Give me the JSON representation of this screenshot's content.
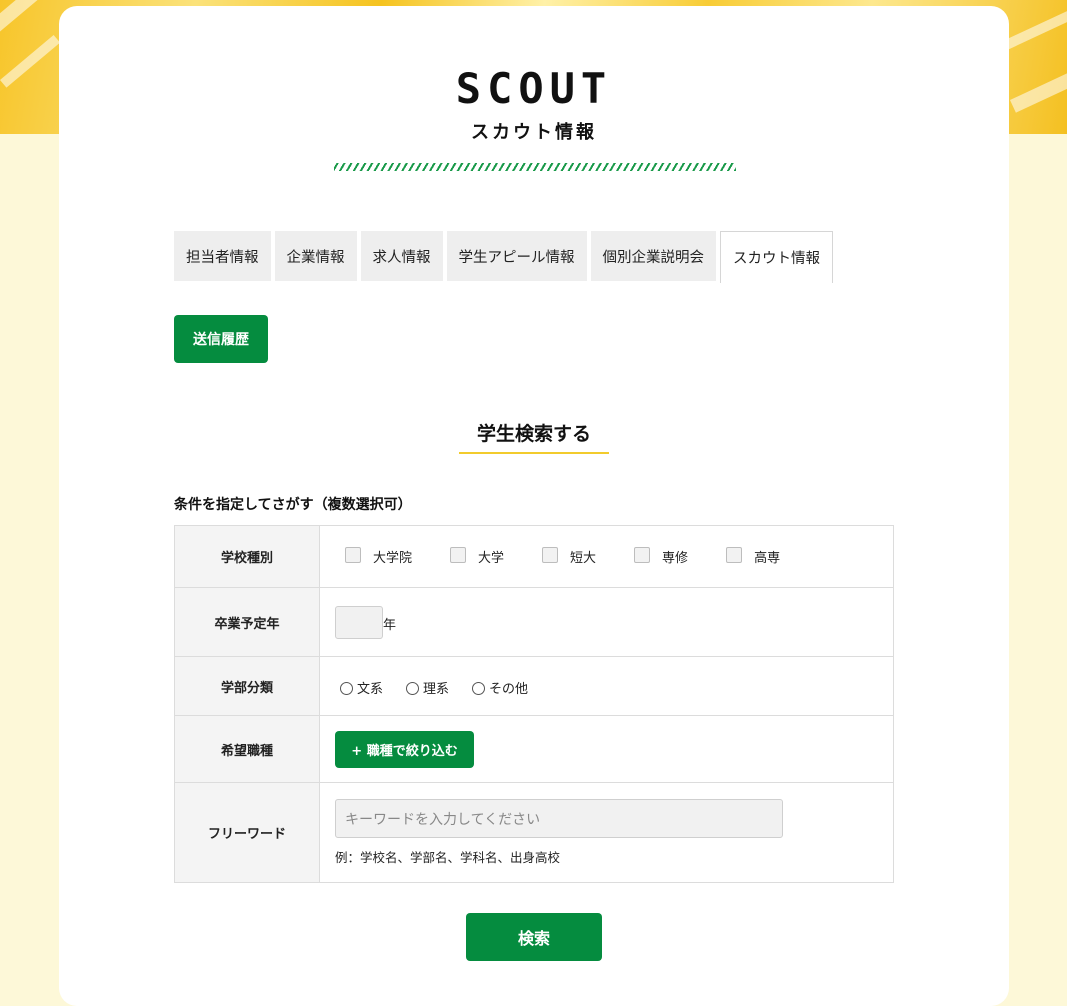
{
  "logo": {
    "title": "SCOUT",
    "subtitle": "スカウト情報"
  },
  "tabs": [
    {
      "label": "担当者情報",
      "active": false
    },
    {
      "label": "企業情報",
      "active": false
    },
    {
      "label": "求人情報",
      "active": false
    },
    {
      "label": "学生アピール情報",
      "active": false
    },
    {
      "label": "個別企業説明会",
      "active": false
    },
    {
      "label": "スカウト情報",
      "active": true
    }
  ],
  "history_button": "送信履歴",
  "section_title": "学生検索する",
  "conditions_label": "条件を指定してさがす（複数選択可）",
  "form": {
    "school_type": {
      "label": "学校種別",
      "options": [
        "大学院",
        "大学",
        "短大",
        "専修",
        "高専"
      ]
    },
    "graduation_year": {
      "label": "卒業予定年",
      "value": "",
      "unit": "年"
    },
    "faculty": {
      "label": "学部分類",
      "options": [
        "文系",
        "理系",
        "その他"
      ]
    },
    "job_type": {
      "label": "希望職種",
      "button": "+ 職種で絞り込む"
    },
    "freeword": {
      "label": "フリーワード",
      "placeholder": "キーワードを入力してください",
      "hint": "例：学校名、学部名、学科名、出身高校"
    }
  },
  "search_button": "検索",
  "colors": {
    "accent_green": "#058c3f",
    "accent_yellow": "#f2cb2c",
    "page_bg": "#fdf8d8"
  }
}
